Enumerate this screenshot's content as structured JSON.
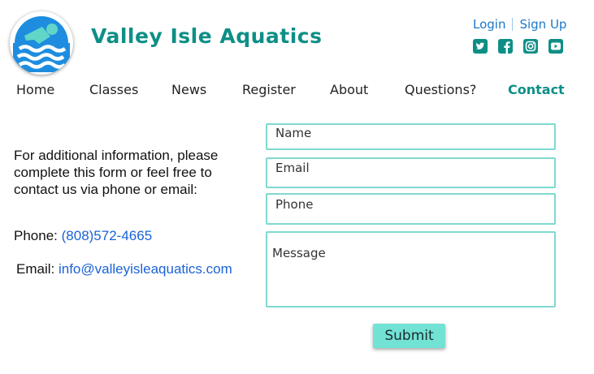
{
  "header": {
    "brand": "Valley Isle Aquatics",
    "logo_icon": "swimmer-icon",
    "auth": {
      "login": "Login",
      "signup": "Sign Up"
    },
    "socials": [
      "twitter-icon",
      "facebook-icon",
      "instagram-icon",
      "youtube-icon"
    ]
  },
  "nav": {
    "items": [
      "Home",
      "Classes",
      "News",
      "Register",
      "About",
      "Questions?",
      "Contact"
    ],
    "active": "Contact"
  },
  "info": {
    "intro": "For additional information, please complete this form or feel free to contact us via phone or email:",
    "phone_label": "Phone:",
    "phone_value": "(808)572-4665",
    "email_label": "Email:",
    "email_value": "info@valleyisleaquatics.com"
  },
  "form": {
    "name_placeholder": "Name",
    "email_placeholder": "Email",
    "phone_placeholder": "Phone",
    "message_placeholder": "Message",
    "submit_label": "Submit"
  },
  "colors": {
    "brand": "#0e8f86",
    "link": "#1b78c8",
    "field_border": "#7fd9d0",
    "button": "#72e2d5",
    "logo_blue": "#1e8de0",
    "logo_accent": "#61d6c8"
  }
}
